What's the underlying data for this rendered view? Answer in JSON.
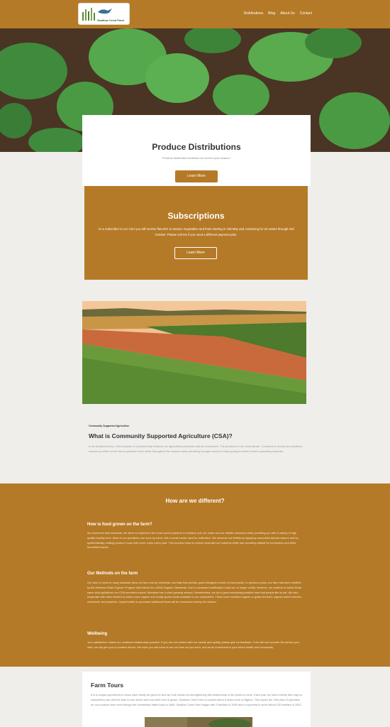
{
  "header": {
    "logo_text": "Swallow Crest Farm",
    "nav": [
      "Distributions",
      "Blog",
      "About Us",
      "Contact"
    ]
  },
  "distributions": {
    "title": "Produce Distributions",
    "subtitle": "Produce distribution timelines for current year season*",
    "button": "Learn More"
  },
  "subscriptions": {
    "title": "Subscriptions",
    "text": "As a subscriber to our CSA you will receive flavorful, in-season vegetables and fruits starting in mid-May and continuing for 23 weeks through mid October. Please call me if you need a different payment plan.",
    "button": "Learn More"
  },
  "csa": {
    "eyebrow": "Community Supported Agriculture",
    "title": "What is Community Supported Agriculture (CSA)?",
    "text": "In its simplest terms, CSA consists of a partnership between an agricultural producer and its consumers. The producer is the local farmer. Consumers, known as members, receive a portion of the farm's produce each week throughout the season while providing enough money in early spring to meet a farm's operating expense."
  },
  "different": {
    "title": "How are we different?",
    "sections": [
      {
        "heading": "How is food grown on the farm?",
        "text": "As concerned land stewards, we strive to implement the most sound practices to enhance soil, air, water and our wildlife resources while providing you with a variety of high quality healthy food. Most of our operations are done by hand, with a small tractor used for cultivation. We enhance soil fertility by applying composted animal manure and by systematically rotating produce crops with cover crops every year. This process helps to restore essential soil nutrients while also providing habitat for honeybees and other beneficial insects."
      },
      {
        "heading": "Our Methods on the farm",
        "text": "Our farm is home to many swallows (thus our farm name), bluebirds, and bats that provide good biological control of insect pests. In previous years, our farm has been certified by the Montana State Organic Program that follows the USDA Organic Standards. Due to increased certification costs we no longer certify, however, we continue to follow those same strict guidelines our CSA members expect. Montana has a short growing season. Nevertheless, we try to grow everything possible here that people like to eat. We also cooperate with other farmers to make more organic and locally grown foods available to our subscribers. These have included organic or grass fed beef, organic sweet cherries, nectarines, and peaches. Opportunities to purchase additional foods will be announced during the season."
      },
      {
        "heading": "Wellbeing",
        "text": "Your satisfaction makes our continued relationship possible. If you are not content with our variety and quality, please give us feedback. If we still can't provide the service you wish, we will give you a prorated refund. We hope you will come to see our farm as your farm, and as an investment in your future health and community."
      }
    ]
  },
  "tours": {
    "title": "Farm Tours",
    "text": "It is a unique opportunity to know each family we grow for and we look forward to strengthening this relationship in the years to come. Each year we host a family farm day so subscribers can visit the farm to see where and how their food is grown. Swallow Crest Farm is located about 6 miles north of Bigfork. This marks the 13th year of operation for our produce farm even though the homestead dates back to 1889. Swallow Crest Farm began with 5 families in 1996 and is expected to serve about 220 families in 2020."
  },
  "colors": {
    "brand": "#b57a27",
    "background": "#efeeeb"
  }
}
